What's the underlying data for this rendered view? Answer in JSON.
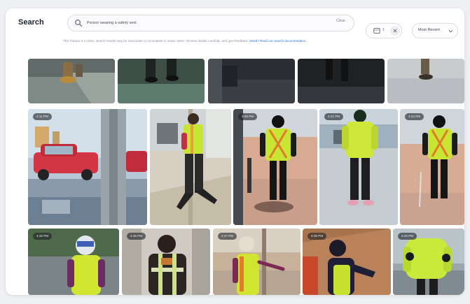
{
  "header": {
    "title": "Search",
    "search": {
      "value": "Person wearing a safety vest",
      "placeholder": "",
      "clear_label": "Clear"
    },
    "filter": {
      "count": "1"
    },
    "sort": {
      "selected": "Most Recent"
    },
    "hint": {
      "text": "This feature is in beta, search results may be inaccurate or incomplete in some cases. Review results carefully, and give feedback. ",
      "link": "Need? Read our search documentation."
    }
  },
  "results": {
    "timestamps": {
      "r2c1": "4:11 PM",
      "r2c2": "",
      "r2c3": "4:46 PM",
      "r2c4": "4:21 PM",
      "r2c5": "4:24 PM",
      "r3c1": "4:42 PM",
      "r3c2": "4:45 PM",
      "r3c3": "4:47 PM",
      "r3c4": "4:39 PM",
      "r3c5": "4:33 PM"
    }
  },
  "colors": {
    "accent_link": "#2f6fd6",
    "vest": "#c8e534",
    "border": "#d8dce3"
  },
  "icons": [
    "search-icon",
    "image-icon",
    "close-icon",
    "chevron-down-icon"
  ]
}
